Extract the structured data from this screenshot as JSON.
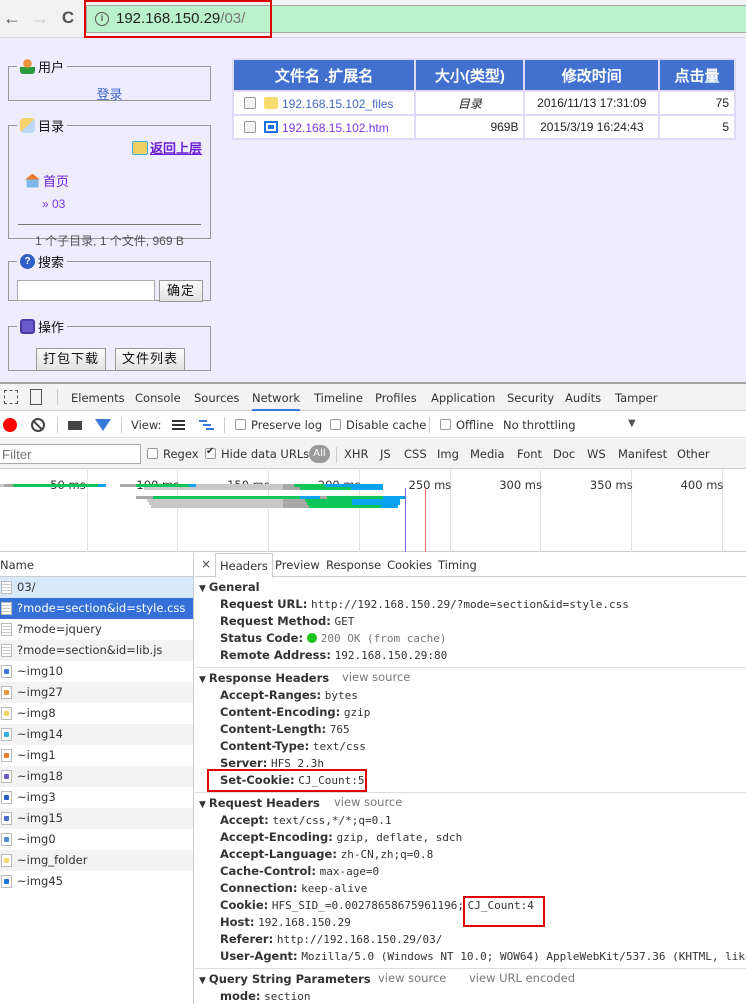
{
  "browser": {
    "url_host": "192.168.150.29",
    "url_path": "/03/",
    "back_icon": "←",
    "forward_icon": "→",
    "reload_icon": "C",
    "info_icon": "i"
  },
  "sidebar": {
    "user": {
      "legend": "用户",
      "login_link": "登录"
    },
    "directory": {
      "legend": "目录",
      "up_link": "返回上层",
      "home_link": "首页",
      "current": "» 03",
      "summary": "1 个子目录, 1 个文件, 969 B"
    },
    "search": {
      "legend": "搜索",
      "input_value": "",
      "submit": "确定"
    },
    "operations": {
      "legend": "操作",
      "zip_button": "打包下载",
      "list_button": "文件列表"
    }
  },
  "file_table": {
    "headers": [
      "文件名 .扩展名",
      "大小(类型)",
      "修改时间",
      "点击量"
    ],
    "rows": [
      {
        "name": "192.168.15.102_files",
        "type": "folder",
        "size": "目录",
        "modified": "2016/11/13 17:31:09",
        "hits": "75"
      },
      {
        "name": "192.168.15.102.htm",
        "type": "htm",
        "size": "969B",
        "modified": "2015/3/19 16:24:43",
        "hits": "5"
      }
    ]
  },
  "devtools": {
    "tabs": [
      "Elements",
      "Console",
      "Sources",
      "Network",
      "Timeline",
      "Profiles",
      "Application",
      "Security",
      "Audits",
      "Tamper"
    ],
    "active_tab": "Network",
    "toolbar": {
      "view_label": "View:",
      "preserve_log": "Preserve log",
      "disable_cache": "Disable cache",
      "offline": "Offline",
      "throttling": "No throttling"
    },
    "filter": {
      "placeholder": "Filter",
      "regex": "Regex",
      "hide_data_urls": "Hide data URLs",
      "hide_data_urls_checked": true,
      "types": [
        "All",
        "XHR",
        "JS",
        "CSS",
        "Img",
        "Media",
        "Font",
        "Doc",
        "WS",
        "Manifest",
        "Other"
      ]
    },
    "timeline": {
      "ticks": [
        "50 ms",
        "100 ms",
        "150 ms",
        "200 ms",
        "250 ms",
        "300 ms",
        "350 ms",
        "400 ms"
      ],
      "dom_content_loaded_ms": 226,
      "load_ms": 237,
      "colors": {
        "waiting": "#0cc65a",
        "download": "#0aa3f0",
        "stalled": "#c8c8c8",
        "queue": "#a8a8a8",
        "dcl": "#7a63f0",
        "load": "#f06a6a"
      }
    },
    "requests": {
      "header": "Name",
      "items": [
        {
          "name": "03/",
          "kind": "doc"
        },
        {
          "name": "?mode=section&id=style.css",
          "kind": "doc",
          "selected": true
        },
        {
          "name": "?mode=jquery",
          "kind": "doc"
        },
        {
          "name": "?mode=section&id=lib.js",
          "kind": "doc"
        },
        {
          "name": "~img10",
          "kind": "img",
          "color": "#3b7be0"
        },
        {
          "name": "~img27",
          "kind": "img",
          "color": "#e8943a"
        },
        {
          "name": "~img8",
          "kind": "img",
          "color": "#f3d46a"
        },
        {
          "name": "~img14",
          "kind": "img",
          "color": "#3aaee8"
        },
        {
          "name": "~img1",
          "kind": "img",
          "color": "#e87c2c"
        },
        {
          "name": "~img18",
          "kind": "img",
          "color": "#6b5bc9"
        },
        {
          "name": "~img3",
          "kind": "img",
          "color": "#2f5ec9"
        },
        {
          "name": "~img15",
          "kind": "img",
          "color": "#4a6ad0"
        },
        {
          "name": "~img0",
          "kind": "img",
          "color": "#4a90d0"
        },
        {
          "name": "~img_folder",
          "kind": "img",
          "color": "#f6dc6e"
        },
        {
          "name": "~img45",
          "kind": "img",
          "color": "#1b72e0"
        }
      ]
    },
    "detail": {
      "close": "×",
      "tabs": [
        "Headers",
        "Preview",
        "Response",
        "Cookies",
        "Timing"
      ],
      "active_tab": "Headers",
      "general": {
        "title": "General",
        "rows": [
          {
            "key": "Request URL:",
            "value": "http://192.168.150.29/?mode=section&id=style.css"
          },
          {
            "key": "Request Method:",
            "value": "GET"
          },
          {
            "key": "Status Code:",
            "value": "200 OK (from cache)",
            "status_dot": true
          },
          {
            "key": "Remote Address:",
            "value": "192.168.150.29:80"
          }
        ]
      },
      "response_headers": {
        "title": "Response Headers",
        "view_source": "view source",
        "rows": [
          {
            "key": "Accept-Ranges:",
            "value": "bytes"
          },
          {
            "key": "Content-Encoding:",
            "value": "gzip"
          },
          {
            "key": "Content-Length:",
            "value": "765"
          },
          {
            "key": "Content-Type:",
            "value": "text/css"
          },
          {
            "key": "Server:",
            "value": "HFS 2.3h"
          },
          {
            "key": "Set-Cookie:",
            "value": "CJ_Count:5",
            "highlighted": true
          }
        ]
      },
      "request_headers": {
        "title": "Request Headers",
        "view_source": "view source",
        "rows": [
          {
            "key": "Accept:",
            "value": "text/css,*/*;q=0.1"
          },
          {
            "key": "Accept-Encoding:",
            "value": "gzip, deflate, sdch"
          },
          {
            "key": "Accept-Language:",
            "value": "zh-CN,zh;q=0.8"
          },
          {
            "key": "Cache-Control:",
            "value": "max-age=0"
          },
          {
            "key": "Connection:",
            "value": "keep-alive"
          },
          {
            "key": "Cookie:",
            "value": "HFS_SID_=0.00278658675961196;",
            "value_highlight": "CJ_Count:4"
          },
          {
            "key": "Host:",
            "value": "192.168.150.29"
          },
          {
            "key": "Referer:",
            "value": "http://192.168.150.29/03/"
          },
          {
            "key": "User-Agent:",
            "value": "Mozilla/5.0 (Windows NT 10.0; WOW64) AppleWebKit/537.36 (KHTML, like"
          }
        ]
      },
      "query_params": {
        "title": "Query String Parameters",
        "view_source": "view source",
        "view_url_encoded": "view URL encoded",
        "rows": [
          {
            "key": "mode:",
            "value": "section"
          }
        ]
      }
    }
  }
}
